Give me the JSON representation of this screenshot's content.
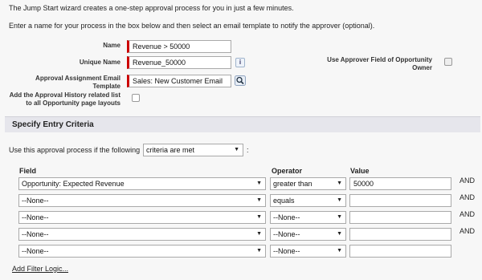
{
  "intro": {
    "line1": "The Jump Start wizard creates a one-step approval process for you in just a few minutes.",
    "line2": "Enter a name for your process in the box below and then select an email template to notify the approver (optional)."
  },
  "form": {
    "name_label": "Name",
    "name_value": "Revenue > 50000",
    "unique_name_label": "Unique Name",
    "unique_name_value": "Revenue_50000",
    "info_icon": "i",
    "email_template_label": "Approval Assignment Email Template",
    "email_template_value": "Sales: New Customer Email",
    "history_label": "Add the Approval History related list to all Opportunity page layouts",
    "approver_field_label": "Use Approver Field of Opportunity Owner"
  },
  "section": {
    "title": "Specify Entry Criteria"
  },
  "criteria": {
    "prefix": "Use this approval process if the following",
    "select_value": "criteria are met",
    "suffix": ":"
  },
  "filter": {
    "headers": {
      "field": "Field",
      "operator": "Operator",
      "value": "Value"
    },
    "rows": [
      {
        "field": "Opportunity: Expected Revenue",
        "operator": "greater than",
        "value": "50000",
        "conj": "AND"
      },
      {
        "field": "--None--",
        "operator": "equals",
        "value": "",
        "conj": "AND"
      },
      {
        "field": "--None--",
        "operator": "--None--",
        "value": "",
        "conj": "AND"
      },
      {
        "field": "--None--",
        "operator": "--None--",
        "value": "",
        "conj": "AND"
      },
      {
        "field": "--None--",
        "operator": "--None--",
        "value": "",
        "conj": ""
      }
    ],
    "add_logic_link": "Add Filter Logic..."
  },
  "icons": {
    "lookup": "magnifier-icon",
    "info": "info-icon",
    "dropdown": "dropdown-arrow-icon"
  }
}
